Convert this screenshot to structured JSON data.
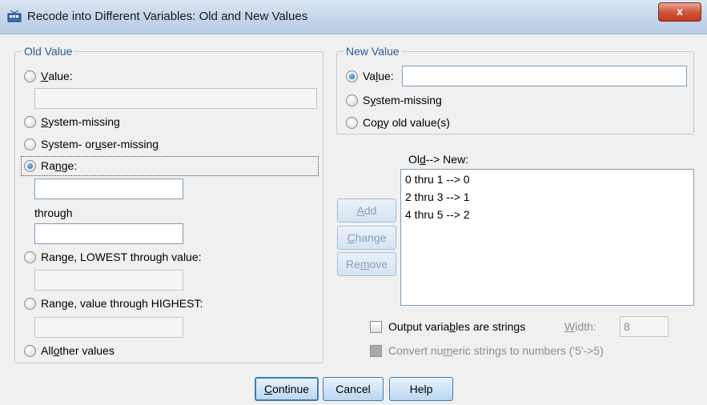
{
  "window": {
    "title": "Recode into Different Variables: Old and New Values",
    "close_label": "x"
  },
  "old_value": {
    "legend": "Old Value",
    "value": {
      "label_pre": "",
      "mn": "V",
      "label_post": "alue:",
      "checked": false
    },
    "system_missing": {
      "label_pre": "",
      "mn": "S",
      "label_post": "ystem-missing",
      "checked": false
    },
    "system_or_user_missing": {
      "label_pre": "System- or ",
      "mn": "u",
      "label_post": "ser-missing",
      "checked": false
    },
    "range": {
      "label_pre": "Ra",
      "mn": "n",
      "label_post": "ge:",
      "checked": true
    },
    "through_label": "through",
    "range_lowest": {
      "label_pre": "Range, LOWEST through value:",
      "checked": false
    },
    "range_highest": {
      "label_pre": "Ran",
      "mn": "g",
      "label_post": "e, value through HIGHEST:",
      "checked": false
    },
    "all_other": {
      "label_pre": "All ",
      "mn": "o",
      "label_post": "ther values",
      "checked": false
    }
  },
  "new_value": {
    "legend": "New Value",
    "value": {
      "label_pre": "Va",
      "mn": "l",
      "label_post": "ue:",
      "checked": true
    },
    "system_missing": {
      "label_pre": "S",
      "mn": "y",
      "label_post": "stem-missing",
      "checked": false
    },
    "copy_old": {
      "label_pre": "Co",
      "mn": "p",
      "label_post": "y old value(s)",
      "checked": false
    }
  },
  "mapping": {
    "label_pre": "Ol",
    "mn": "d",
    "label_post": " --> New:",
    "items": [
      "0 thru 1 --> 0",
      "2 thru 3 --> 1",
      "4 thru 5 --> 2"
    ]
  },
  "side_buttons": {
    "add": {
      "label_pre": "",
      "mn": "A",
      "label_post": "dd"
    },
    "change": {
      "label_pre": "",
      "mn": "C",
      "label_post": "hange"
    },
    "remove": {
      "label_pre": "Re",
      "mn": "m",
      "label_post": "ove"
    }
  },
  "options": {
    "output_strings": {
      "label_pre": "Output varia",
      "mn": "b",
      "label_post": "les are strings",
      "checked": false
    },
    "width_label_pre": "",
    "width_mn": "W",
    "width_label_post": "idth:",
    "width_value": "8",
    "convert_numeric": {
      "label_pre": "Convert nu",
      "mn": "m",
      "label_post": "eric strings to numbers ('5'->5)",
      "checked": false
    }
  },
  "footer": {
    "continue": {
      "label_pre": "",
      "mn": "C",
      "label_post": "ontinue"
    },
    "cancel": "Cancel",
    "help": "Help"
  }
}
